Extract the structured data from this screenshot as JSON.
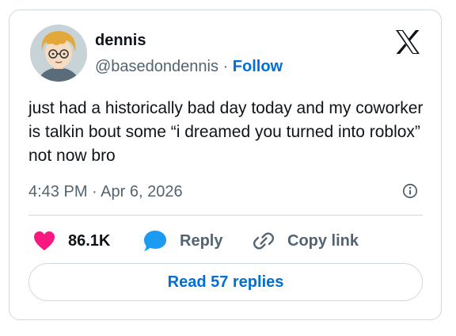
{
  "author": {
    "name": "dennis",
    "handle": "@basedondennis",
    "separator": "·",
    "follow_label": "Follow",
    "avatar_icon": "anime-character-avatar"
  },
  "brand": {
    "icon": "x-logo-icon"
  },
  "tweet": {
    "text": "just had a historically bad day today and my coworker is talkin bout some “i dreamed you turned into roblox” not now bro",
    "time": "4:43 PM",
    "separator": "·",
    "date": "Apr 6, 2026"
  },
  "actions": {
    "like_count": "86.1K",
    "reply_label": "Reply",
    "copy_link_label": "Copy link"
  },
  "read_replies_label": "Read 57 replies",
  "colors": {
    "link": "#006fd6",
    "heart": "#f91880",
    "reply_bubble": "#1d9bf0",
    "muted": "#536471",
    "border": "#cfd9de"
  }
}
